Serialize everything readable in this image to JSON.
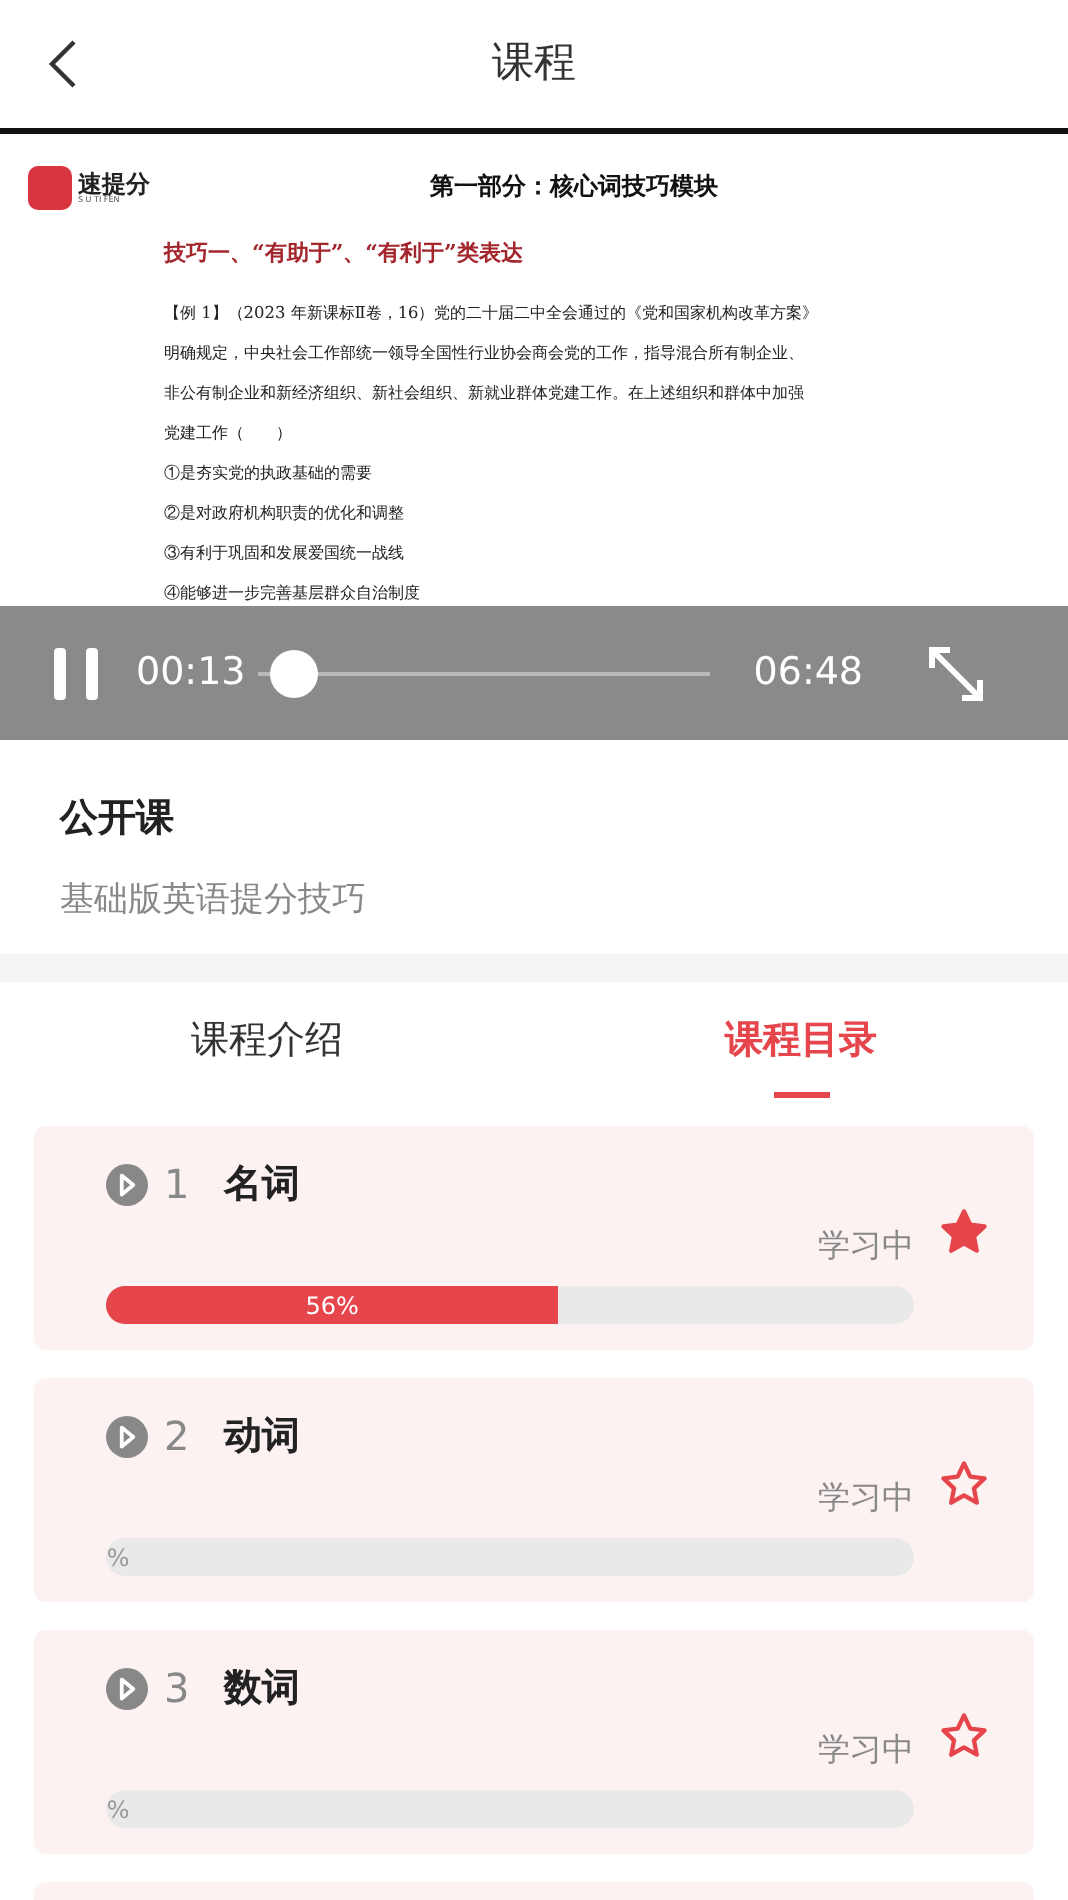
{
  "header": {
    "title": "课程"
  },
  "video": {
    "document": {
      "brand": "速提分",
      "brand_sub": "S U  TI FEN",
      "title": "第一部分：核心词技巧模块",
      "heading": "技巧一、“有助于”、“有利于”类表达",
      "lines": [
        "【例 1】（2023 年新课标Ⅱ卷，16）党的二十届二中全会通过的《党和国家机构改革方案》",
        "明确规定，中央社会工作部统一领导全国性行业协会商会党的工作，指导混合所有制企业、",
        "非公有制企业和新经济组织、新社会组织、新就业群体党建工作。在上述组织和群体中加强",
        "党建工作（　　）",
        "①是夯实党的执政基础的需要",
        "②是对政府机构职责的优化和调整",
        "③有利于巩固和发展爱国统一战线",
        "④能够进一步完善基层群众自治制度"
      ]
    },
    "playing": true,
    "current": "00:13",
    "duration": "06:48",
    "level": 0.03
  },
  "course": {
    "type": "公开课",
    "name": "基础版英语提分技巧"
  },
  "tabs": [
    {
      "label": "课程介绍",
      "selected": false
    },
    {
      "label": "课程目录",
      "selected": true
    }
  ],
  "lessons": [
    {
      "number": "1",
      "title": "名词",
      "status": "学习中",
      "favorite": true,
      "level": 0.56,
      "percent": "56%"
    },
    {
      "number": "2",
      "title": "动词",
      "status": "学习中",
      "favorite": false,
      "level": 0,
      "percent": "%"
    },
    {
      "number": "3",
      "title": "数词",
      "status": "学习中",
      "favorite": false,
      "level": 0,
      "percent": "%"
    }
  ]
}
